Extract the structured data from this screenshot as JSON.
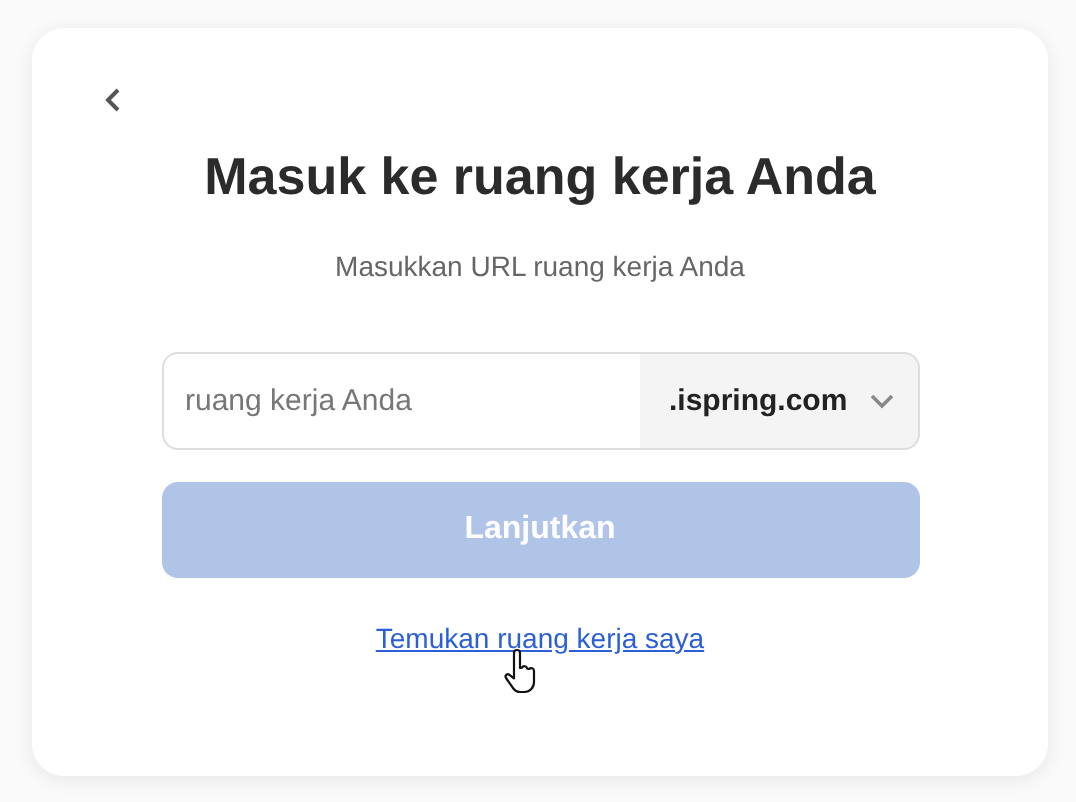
{
  "title": "Masuk ke ruang kerja Anda",
  "subtitle": "Masukkan URL ruang kerja Anda",
  "workspace_field": {
    "placeholder": "ruang kerja Anda"
  },
  "domain_select": {
    "value": ".ispring.com"
  },
  "continue_button": {
    "label": "Lanjutkan",
    "disabled": true
  },
  "find_link": "Temukan ruang kerja saya"
}
